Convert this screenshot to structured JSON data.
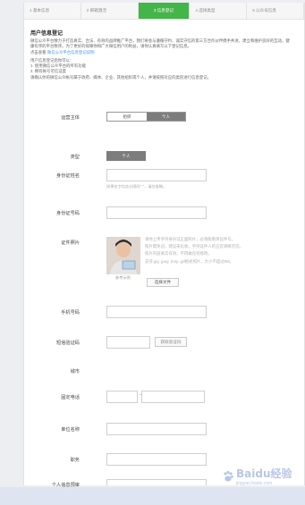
{
  "steps": [
    {
      "label": "1 基本信息"
    },
    {
      "label": "2 邮箱激活"
    },
    {
      "label": "3 信息登记"
    },
    {
      "label": "4 选择类型"
    },
    {
      "label": "5 公众号信息"
    }
  ],
  "section": {
    "title": "用户信息登记",
    "intro": "微信公众平台致力于打造真实、合法、有效的品牌推广平台，我们将会与遵循守约、诚实守信的第三方合作伙伴携手共进，建立和维护良好的互动，健康有序的平台秩序。为了更好的保障你和广大微信用户的利益，请你认真填写以下登记信息。",
    "details_prefix": "点击查看 ",
    "details_link": "微信公众平台信息登记说明",
    "benefits_title": "用户信息登记后你可以：",
    "benefit1": "1. 使用微信公众平台的所有功能",
    "benefit2": "2. 拥有帐号可信证度",
    "confirm_text": "请确认你的微信公众帐号属于政府、媒体、企业、其他组织或个人，并请按照对应的类别进行信息登记。"
  },
  "entity": {
    "label": "运营主体",
    "options": [
      "组织",
      "个人"
    ],
    "selected": "个人"
  },
  "type": {
    "label": "类型",
    "value": "个人"
  },
  "fields": {
    "id_name": {
      "label": "身份证姓名",
      "value": "",
      "hint": "如果名字包含分隔号\"·\"，请勿省略。"
    },
    "id_number": {
      "label": "身份证号码",
      "value": ""
    },
    "id_photo": {
      "label": "证件照片",
      "caption": "参考示例",
      "hints": [
        "请你上传手持身份证正面照片，必须能看清证件号。",
        "照片需免冠，建议未化妆，手持证件人的五官清晰可见。",
        "照片内容真实有效，不得做任何修改。",
        "支持.jpg .jpeg .bmp .gif格式照片，大小不超过5M。"
      ],
      "upload_button": "选择文件"
    },
    "phone": {
      "label": "手机号码",
      "value": ""
    },
    "sms_code": {
      "label": "短信验证码",
      "value": "",
      "button": "获取验证码"
    },
    "city": {
      "label": "城市"
    },
    "landline": {
      "label": "固定电话",
      "area": "",
      "number": "",
      "separator": "-"
    },
    "company": {
      "label": "单位名称",
      "value": ""
    },
    "position": {
      "label": "职务",
      "value": ""
    },
    "extra": {
      "label": "个人信息预审"
    }
  },
  "watermark": {
    "text": "Baidu经验",
    "sub": "jingyan.baidu.com"
  }
}
